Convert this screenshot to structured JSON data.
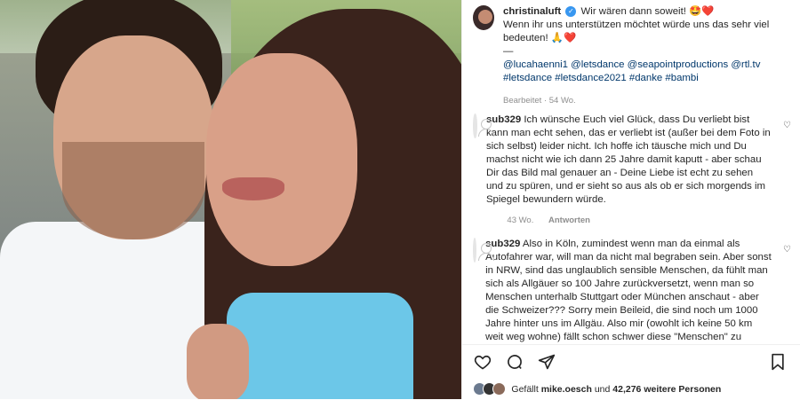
{
  "photo": {
    "alt_description": ""
  },
  "post": {
    "username": "christinaluft",
    "caption_line1": "Wir wären dann soweit! 🤩❤️",
    "caption_line2": "Wenn ihr uns unterstützen möchtet würde uns das sehr viel bedeuten! 🙏❤️",
    "separator": "—",
    "tags_line1": "@lucahaenni1 @letsdance @seapointproductions @rtl.tv",
    "tags_line2": "#letsdance #letsdance2021 #danke #bambi",
    "meta": "Bearbeitet · 54 Wo."
  },
  "comments": [
    {
      "username": "sub329",
      "text": "Ich wünsche Euch viel Glück, dass Du verliebt bist kann man echt sehen, das er verliebt ist (außer bei dem Foto in sich selbst) leider nicht. Ich hoffe ich täusche mich und Du machst nicht wie ich dann 25 Jahre damit kaputt - aber schau Dir das Bild mal genauer an - Deine Liebe ist echt zu sehen und zu spüren, und er sieht so aus als ob er sich morgends im Spiegel bewundern würde.",
      "age": "43 Wo.",
      "reply": "Antworten"
    },
    {
      "username": "sub329",
      "text": "Also in Köln, zumindest wenn man da einmal als Autofahrer war, will man da nicht mal begraben sein. Aber sonst in NRW, sind das unglaublich sensible Menschen, da fühlt man sich als Allgäuer so 100 Jahre zurückversetzt, wenn man so Menschen unterhalb Stuttgart oder München anschaut - aber die Schweizer??? Sorry mein Beileid, die sind noch um 1000 Jahre hinter uns im Allgäu. Also mir (owohlt ich keine 50 km weit weg wohne) fällt schon schwer diese \"Menschen\" zu"
    }
  ],
  "likes": {
    "prefix": "Gefällt",
    "user": "mike.oesch",
    "middle": "und",
    "count": "42,276",
    "suffix": "weitere Personen"
  },
  "icons": {
    "heart": "heart-icon",
    "comment": "comment-icon",
    "share": "share-icon",
    "bookmark": "bookmark-icon",
    "verified": "verified-badge-icon"
  }
}
